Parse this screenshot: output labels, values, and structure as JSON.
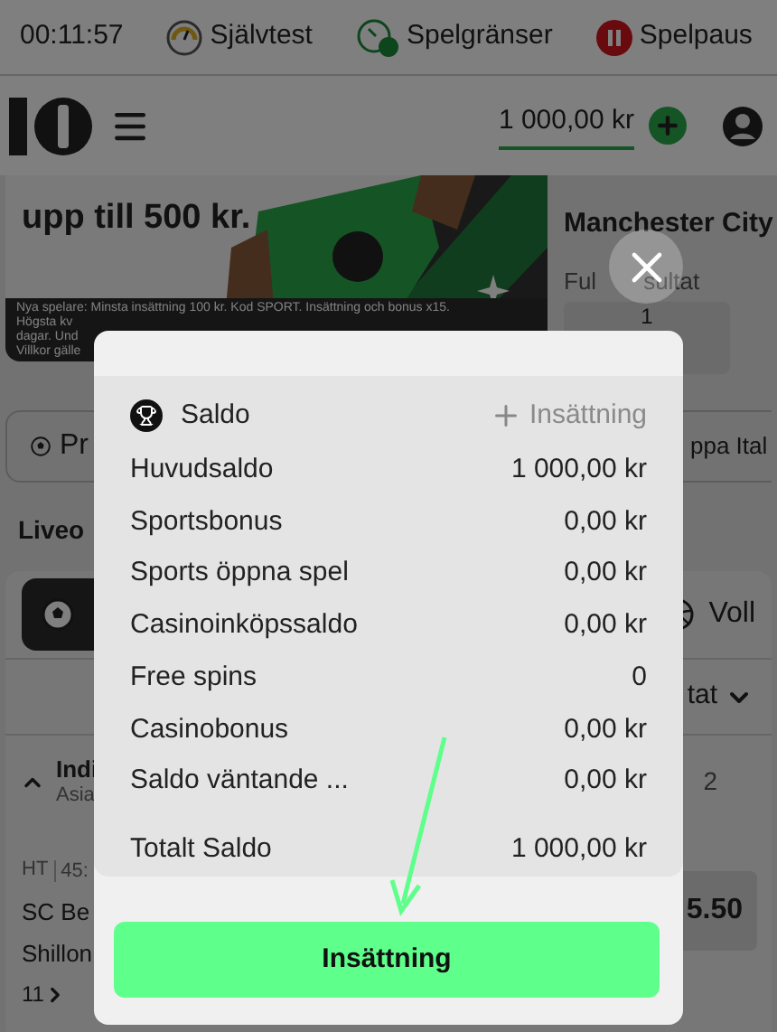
{
  "status_bar": {
    "time": "00:11:57",
    "links": [
      {
        "label": "Självtest",
        "kind": "selftest"
      },
      {
        "label": "Spelgränser",
        "kind": "limits"
      },
      {
        "label": "Spelpaus",
        "kind": "pause"
      }
    ]
  },
  "header": {
    "balance": "1 000,00 kr"
  },
  "banner": {
    "headline": "upp till 500 kr.",
    "fine_print": [
      "Nya spelare: Minsta insättning 100 kr. Kod SPORT. Insättning och bonus x15.",
      "Högsta kv",
      "dagar. Und",
      "Villkor gälle"
    ]
  },
  "match_panel": {
    "team": "Manchester City",
    "market_start": "Ful",
    "market_end": "sultat",
    "odds": "1"
  },
  "filters": {
    "left": "Pr",
    "right": "ppa Ital"
  },
  "live_title": "Liveo",
  "sports": [
    {
      "label": "Voll",
      "kind": "volleyball"
    }
  ],
  "sort_label": "tat",
  "league": {
    "name": "Indi",
    "region": "Asia",
    "expanded": true,
    "column": "2"
  },
  "match": {
    "status": "HT",
    "clock": "45:",
    "teams": [
      "SC Be",
      "Shillon"
    ],
    "more": "11",
    "odds": "5.50"
  },
  "modal": {
    "title": "Saldo",
    "deposit_link": "Insättning",
    "rows": [
      {
        "label": "Huvudsaldo",
        "value": "1 000,00 kr"
      },
      {
        "label": "Sportsbonus",
        "value": "0,00 kr"
      },
      {
        "label": "Sports öppna spel",
        "value": "0,00 kr"
      },
      {
        "label": "Casinoinköpssaldo",
        "value": "0,00 kr"
      },
      {
        "label": "Free spins",
        "value": "0"
      },
      {
        "label": "Casinobonus",
        "value": "0,00 kr"
      },
      {
        "label": "Saldo väntande ...",
        "value": "0,00 kr"
      }
    ],
    "total": {
      "label": "Totalt Saldo",
      "value": "1 000,00 kr"
    },
    "button": "Insättning"
  }
}
